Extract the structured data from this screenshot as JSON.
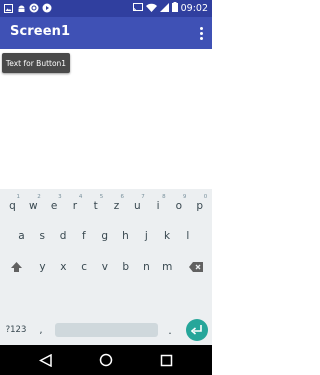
{
  "status_bar": {
    "time": "09:02",
    "icons": [
      "image-icon",
      "android-icon",
      "sync-icon",
      "play-icon",
      "cast-icon",
      "wifi-icon",
      "signal-icon",
      "battery-icon"
    ]
  },
  "app_bar": {
    "title": "Screen1",
    "overflow_icon": "more-vert-icon"
  },
  "content": {
    "button1_label": "Text for Button1"
  },
  "keyboard": {
    "row1": [
      {
        "key": "q",
        "hint": "1"
      },
      {
        "key": "w",
        "hint": "2"
      },
      {
        "key": "e",
        "hint": "3"
      },
      {
        "key": "r",
        "hint": "4"
      },
      {
        "key": "t",
        "hint": "5"
      },
      {
        "key": "z",
        "hint": "6"
      },
      {
        "key": "u",
        "hint": "7"
      },
      {
        "key": "i",
        "hint": "8"
      },
      {
        "key": "o",
        "hint": "9"
      },
      {
        "key": "p",
        "hint": "0"
      }
    ],
    "row2": [
      "a",
      "s",
      "d",
      "f",
      "g",
      "h",
      "j",
      "k",
      "l"
    ],
    "row3": [
      "y",
      "x",
      "c",
      "v",
      "b",
      "n",
      "m"
    ],
    "symbols_label": "?123",
    "comma": ",",
    "period": ".",
    "shift_icon": "shift-icon",
    "backspace_icon": "backspace-icon",
    "enter_icon": "enter-icon",
    "enter_color": "#26a69a"
  },
  "nav_bar": {
    "icons": [
      "back-icon",
      "home-icon",
      "recents-icon"
    ]
  },
  "colors": {
    "status_bar": "#303f9f",
    "app_bar": "#3f51b5",
    "button_bg": "#4a4a4a",
    "keyboard_bg": "#eceff1"
  }
}
